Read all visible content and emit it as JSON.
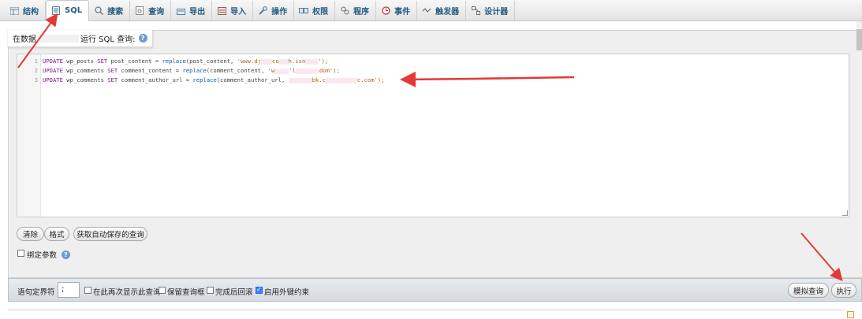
{
  "tabs": [
    {
      "label": "结构",
      "icon": "structure-icon"
    },
    {
      "label": "SQL",
      "icon": "sql-icon",
      "active": true
    },
    {
      "label": "搜索",
      "icon": "search-icon"
    },
    {
      "label": "查询",
      "icon": "query-icon"
    },
    {
      "label": "导出",
      "icon": "export-icon"
    },
    {
      "label": "导入",
      "icon": "import-icon"
    },
    {
      "label": "操作",
      "icon": "wrench-icon"
    },
    {
      "label": "权限",
      "icon": "privileges-icon"
    },
    {
      "label": "程序",
      "icon": "routines-icon"
    },
    {
      "label": "事件",
      "icon": "events-icon"
    },
    {
      "label": "触发器",
      "icon": "triggers-icon"
    },
    {
      "label": "设计器",
      "icon": "designer-icon"
    }
  ],
  "panel": {
    "title_prefix": "在数据",
    "title_suffix": "运行 SQL 查询:",
    "help_glyph": "?"
  },
  "editor": {
    "line_numbers": [
      "1",
      "2",
      "3"
    ],
    "lines": [
      {
        "kw1": "UPDATE",
        "t1": " wp_posts ",
        "kw2": "SET",
        "t2": " post_content = ",
        "fn": "replace",
        "t3": "(post_content, ",
        "s1": "'www.dj",
        "s2": "co",
        "s3": "h.isn",
        "end": "');"
      },
      {
        "kw1": "UPDATE",
        "t1": " wp_comments ",
        "kw2": "SET",
        "t2": " comment_content = ",
        "fn": "replace",
        "t3": "(comment_content, ",
        "s1": "'w",
        "s2": "'l",
        "s3": "dom'",
        "end": ");"
      },
      {
        "kw1": "UPDATE",
        "t1": " wp_comments ",
        "kw2": "SET",
        "t2": " comment_author_url = ",
        "fn": "replace",
        "t3": "(comment_author_url, ",
        "s1": "bk.c",
        "s2": "",
        "s3": "c.com'",
        "end": ");"
      }
    ]
  },
  "buttons": {
    "clear": "清除",
    "format": "格式",
    "get_autosaved": "获取自动保存的查询",
    "bind_params": "绑定参数",
    "simulate": "模拟查询",
    "go": "执行"
  },
  "options": {
    "delimiter_label": "语句定界符",
    "delimiter_value": ";",
    "show_again": "在此再次显示此查询",
    "retain_box": "保留查询框",
    "rollback": "完成后回滚",
    "fk_checks": "启用外键约束",
    "show_again_checked": false,
    "retain_box_checked": false,
    "rollback_checked": false,
    "fk_checks_checked": true,
    "bind_params_checked": false
  },
  "colors": {
    "accent_link": "#235a81",
    "annotation_red": "#e53935"
  }
}
